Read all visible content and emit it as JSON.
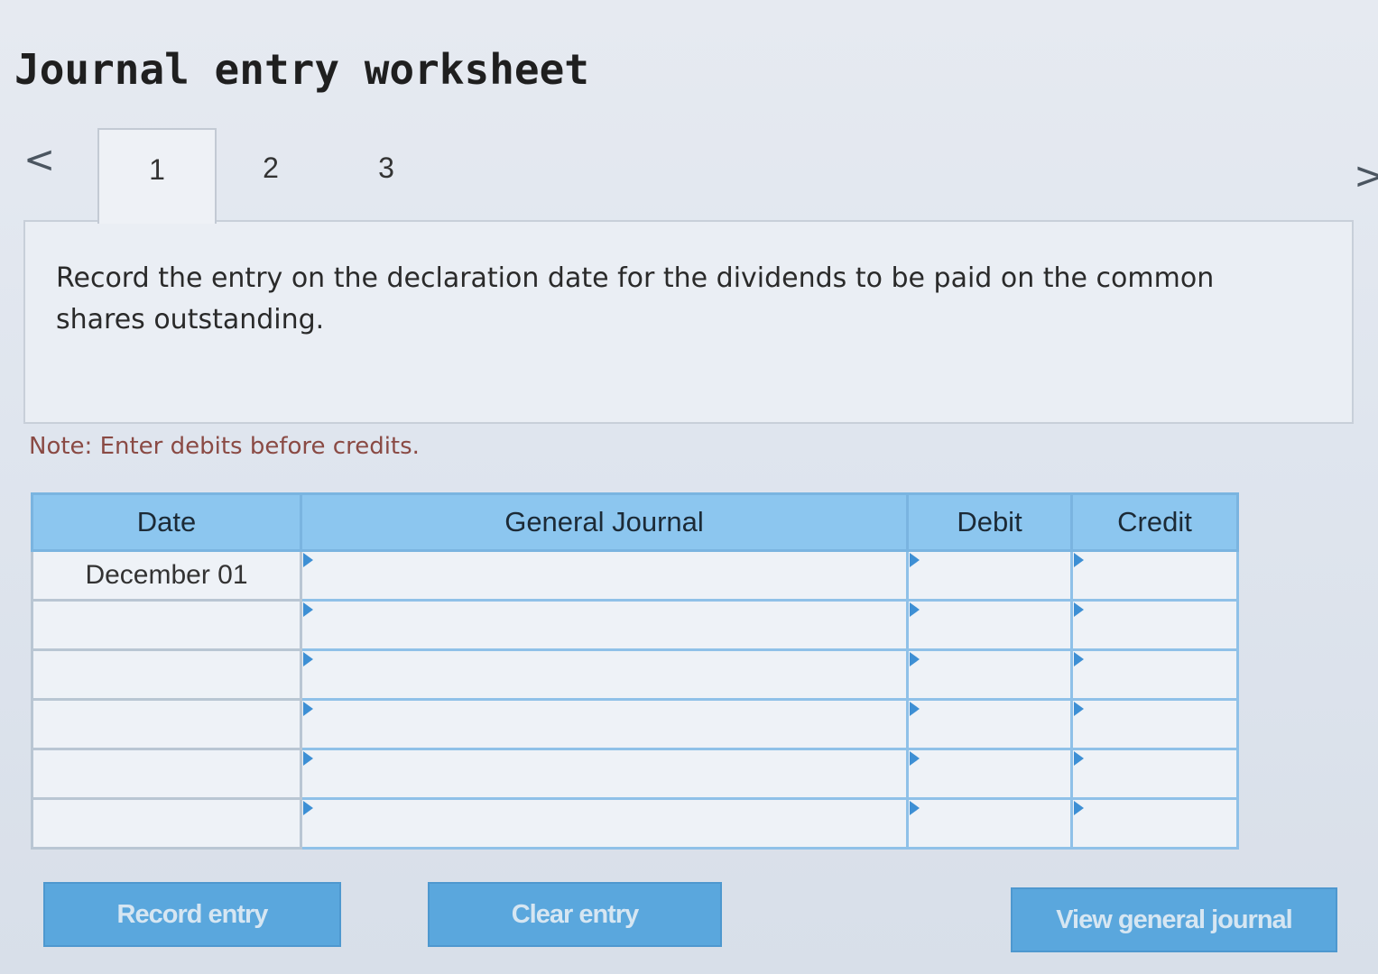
{
  "header": {
    "title": "Journal entry worksheet"
  },
  "navigation": {
    "prev_icon": "chevron-left-icon",
    "next_icon": "chevron-right-icon",
    "prev_glyph": "<",
    "next_glyph": ">",
    "tabs": [
      {
        "label": "1",
        "active": true
      },
      {
        "label": "2",
        "active": false
      },
      {
        "label": "3",
        "active": false
      }
    ]
  },
  "question": {
    "text": "Record the entry on the declaration date for the dividends to be paid on the common shares outstanding."
  },
  "note": "Note: Enter debits before credits.",
  "journal": {
    "columns": [
      "Date",
      "General Journal",
      "Debit",
      "Credit"
    ],
    "rows": [
      {
        "date": "December 01",
        "account": "",
        "debit": "",
        "credit": ""
      },
      {
        "date": "",
        "account": "",
        "debit": "",
        "credit": ""
      },
      {
        "date": "",
        "account": "",
        "debit": "",
        "credit": ""
      },
      {
        "date": "",
        "account": "",
        "debit": "",
        "credit": ""
      },
      {
        "date": "",
        "account": "",
        "debit": "",
        "credit": ""
      },
      {
        "date": "",
        "account": "",
        "debit": "",
        "credit": ""
      }
    ]
  },
  "buttons": {
    "record": "Record entry",
    "clear": "Clear entry",
    "view": "View general journal"
  },
  "colors": {
    "accent": "#5aa7dd",
    "table_header": "#8cc6ef",
    "note_text": "#8a4a44"
  }
}
